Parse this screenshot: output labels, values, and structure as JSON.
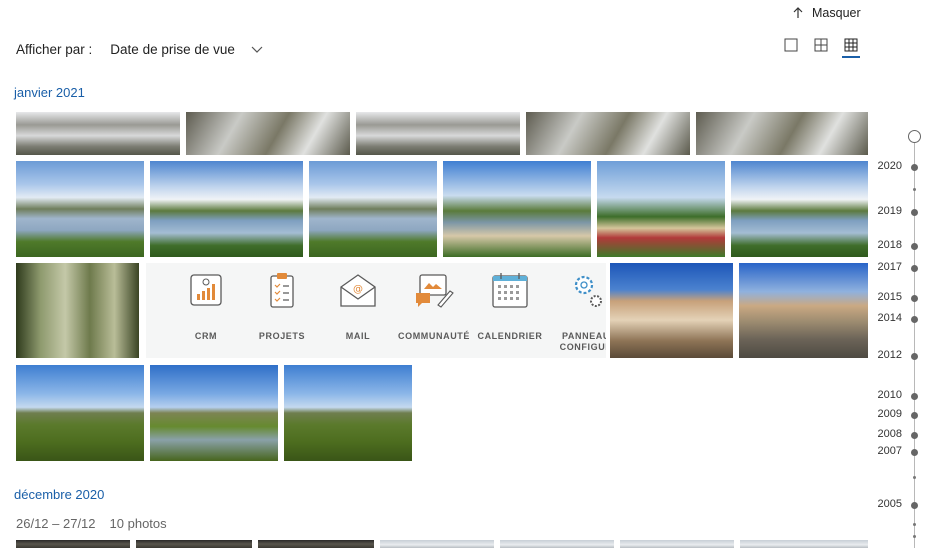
{
  "header": {
    "hide_label": "Masquer",
    "sort_label": "Afficher par :",
    "sort_value": "Date de prise de vue"
  },
  "view_modes": [
    "large",
    "medium",
    "small"
  ],
  "active_view": "small",
  "sections": [
    {
      "title": "janvier 2021"
    },
    {
      "title": "décembre 2020",
      "range": "26/12 – 27/12",
      "count": "10 photos"
    }
  ],
  "apps": [
    {
      "label": "CRM",
      "icon": "crm-chart-icon"
    },
    {
      "label": "PROJETS",
      "icon": "clipboard-checklist-icon"
    },
    {
      "label": "MAIL",
      "icon": "mail-envelope-icon"
    },
    {
      "label": "COMMUNAUTÉ",
      "icon": "community-chat-icon"
    },
    {
      "label": "CALENDRIER",
      "icon": "calendar-icon"
    },
    {
      "label": "PANNEAU\nCONFIGUR",
      "icon": "settings-gears-icon"
    }
  ],
  "timeline": {
    "years": [
      "2020",
      "2019",
      "2018",
      "2017",
      "2015",
      "2014",
      "2012",
      "2010",
      "2009",
      "2008",
      "2007",
      "2005"
    ]
  },
  "colors": {
    "accent": "#1a5fa8",
    "panel": "#f5f6f6"
  }
}
